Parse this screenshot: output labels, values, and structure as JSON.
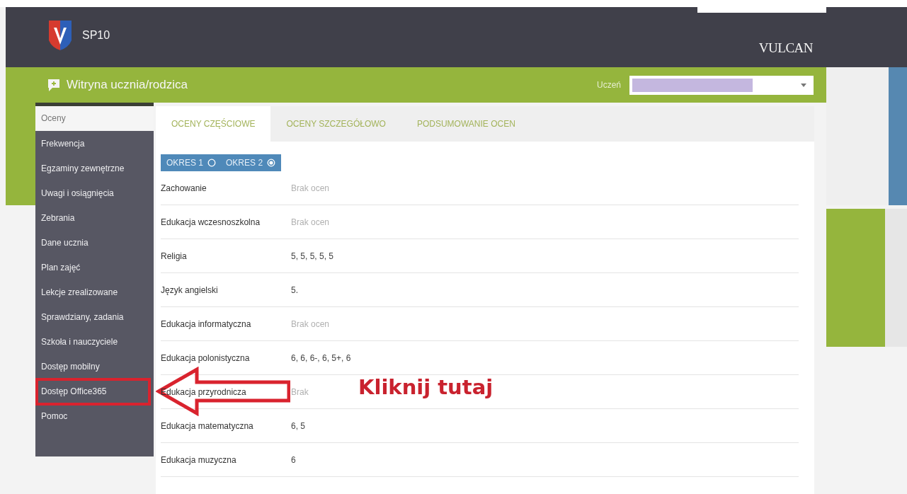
{
  "header": {
    "school": "SP10",
    "brand": "VULCAN"
  },
  "bar": {
    "title": "Witryna ucznia/rodzica",
    "student_label": "Uczeń"
  },
  "sidebar": {
    "items": [
      {
        "label": "Oceny",
        "selected": true
      },
      {
        "label": "Frekwencja",
        "selected": false
      },
      {
        "label": "Egzaminy zewnętrzne",
        "selected": false
      },
      {
        "label": "Uwagi i osiągnięcia",
        "selected": false
      },
      {
        "label": "Zebrania",
        "selected": false
      },
      {
        "label": "Dane ucznia",
        "selected": false
      },
      {
        "label": "Plan zajęć",
        "selected": false
      },
      {
        "label": "Lekcje zrealizowane",
        "selected": false
      },
      {
        "label": "Sprawdziany, zadania",
        "selected": false
      },
      {
        "label": "Szkoła i nauczyciele",
        "selected": false
      },
      {
        "label": "Dostęp mobilny",
        "selected": false
      },
      {
        "label": "Dostęp Office365",
        "selected": false,
        "highlighted": true
      },
      {
        "label": "Pomoc",
        "selected": false
      }
    ]
  },
  "tabs": [
    {
      "label": "OCENY CZĘŚCIOWE",
      "selected": true
    },
    {
      "label": "OCENY SZCZEGÓŁOWO",
      "selected": false
    },
    {
      "label": "PODSUMOWANIE OCEN",
      "selected": false
    }
  ],
  "periods": [
    {
      "label": "OKRES 1",
      "selected": false
    },
    {
      "label": "OKRES 2",
      "selected": true
    }
  ],
  "rows": [
    {
      "subject": "Zachowanie",
      "grades": "Brak ocen",
      "empty": true
    },
    {
      "subject": "Edukacja wczesnoszkolna",
      "grades": "Brak ocen",
      "empty": true
    },
    {
      "subject": "Religia",
      "grades": "5, 5, 5, 5, 5",
      "empty": false
    },
    {
      "subject": "Język angielski",
      "grades": "5.",
      "empty": false
    },
    {
      "subject": "Edukacja informatyczna",
      "grades": "Brak ocen",
      "empty": true
    },
    {
      "subject": "Edukacja polonistyczna",
      "grades": "6, 6, 6-, 6, 5+, 6",
      "empty": false
    },
    {
      "subject": "Edukacja przyrodnicza",
      "grades": "Brak",
      "empty": true
    },
    {
      "subject": "Edukacja matematyczna",
      "grades": "6, 5",
      "empty": false
    },
    {
      "subject": "Edukacja muzyczna",
      "grades": "6",
      "empty": false
    }
  ],
  "annotation": {
    "text": "Kliknij tutaj"
  }
}
